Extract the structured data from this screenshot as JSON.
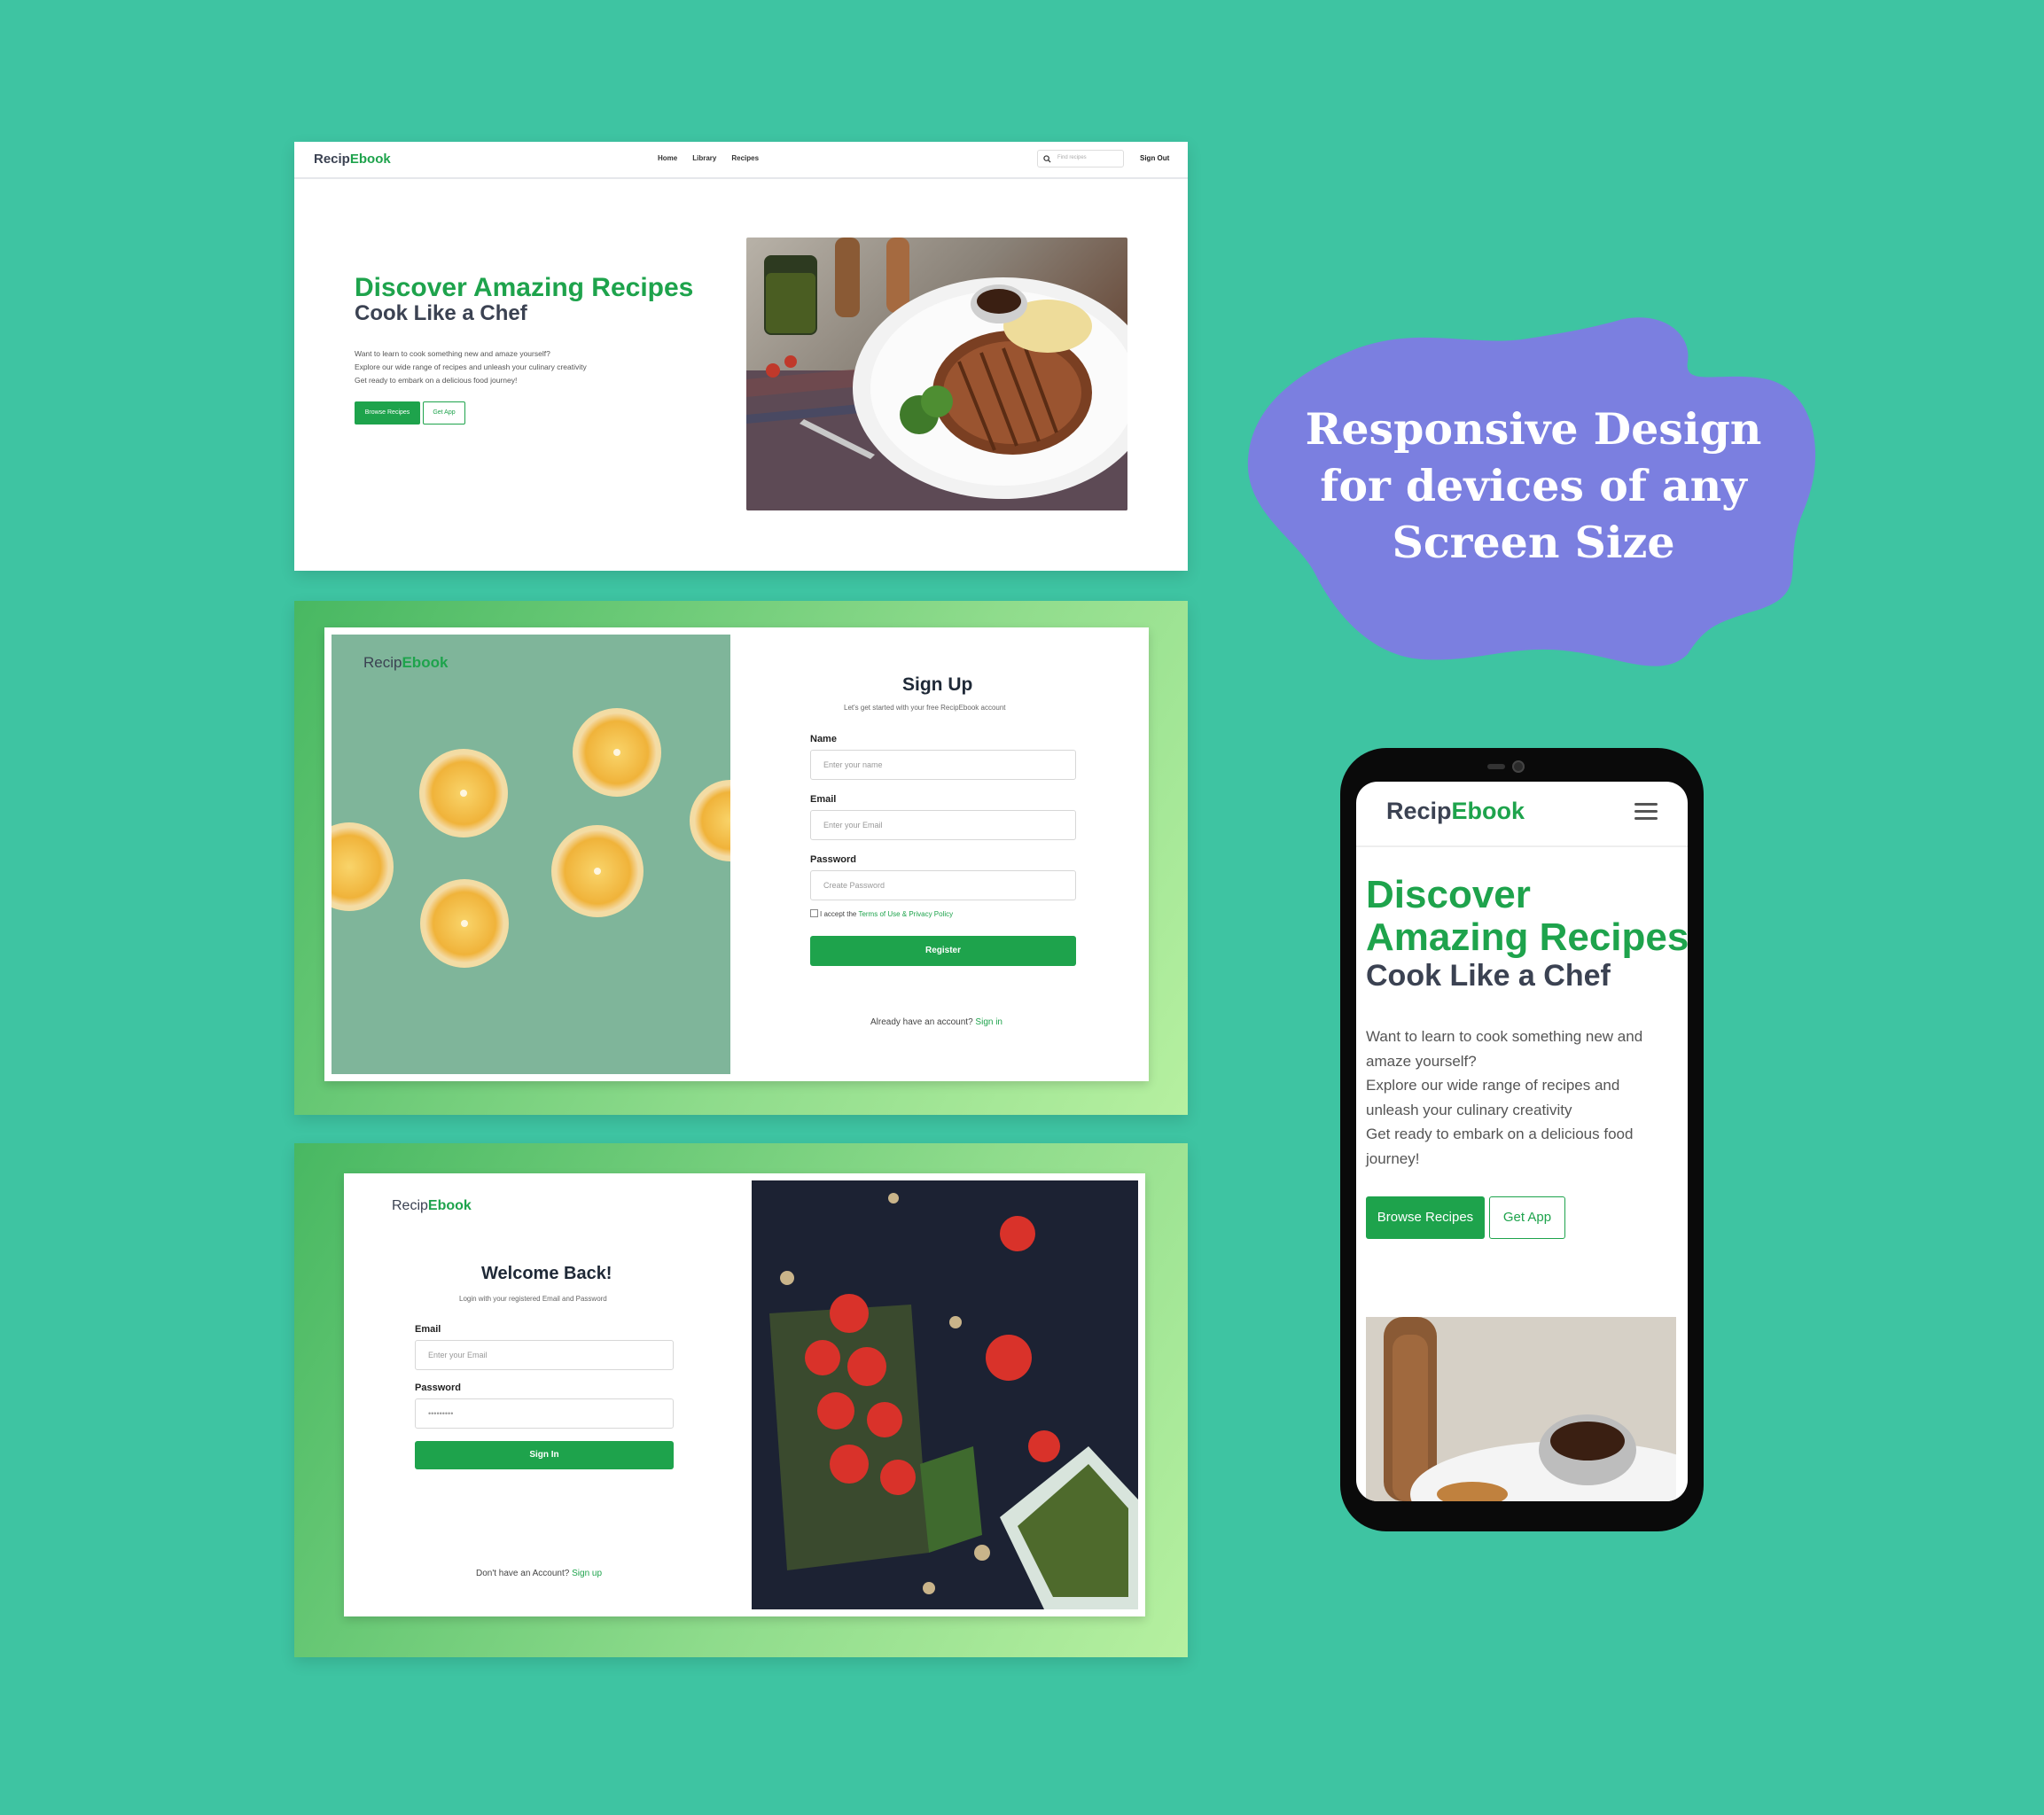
{
  "brand": {
    "part1": "Recip",
    "part2": "Ebook"
  },
  "desktop": {
    "nav": {
      "home": "Home",
      "library": "Library",
      "recipes": "Recipes",
      "search_placeholder": "Find recipes",
      "signout": "Sign Out"
    },
    "hero": {
      "title": "Discover Amazing Recipes",
      "subtitle": "Cook Like a Chef",
      "line1": "Want to learn to cook something new and amaze yourself?",
      "line2": "Explore our wide range of recipes and unleash your culinary creativity",
      "line3": "Get ready to embark on a delicious food journey!",
      "browse": "Browse Recipes",
      "getapp": "Get App"
    }
  },
  "signup": {
    "title": "Sign Up",
    "subtitle": "Let's get started with your free RecipEbook account",
    "name_label": "Name",
    "name_placeholder": "Enter your name",
    "email_label": "Email",
    "email_placeholder": "Enter your Email",
    "password_label": "Password",
    "password_placeholder": "Create Password",
    "terms_prefix": "I accept the ",
    "terms_link": "Terms of Use",
    "terms_amp": " & ",
    "privacy_link": "Privacy Policy",
    "register": "Register",
    "already": "Already have an account? ",
    "signin_link": "Sign in"
  },
  "signin": {
    "title": "Welcome Back!",
    "subtitle": "Login with your registered Email and Password",
    "email_label": "Email",
    "email_placeholder": "Enter your Email",
    "password_label": "Password",
    "password_value": "•••••••••",
    "button": "Sign In",
    "noaccount": "Don't have an Account? ",
    "signup_link": "Sign up"
  },
  "promo": {
    "line1": "Responsive Design",
    "line2": "for devices of any",
    "line3": "Screen Size"
  },
  "mobile": {
    "title": "Discover Amazing Recipes",
    "subtitle": "Cook Like a Chef",
    "desc1": "Want to learn to cook something new and amaze yourself?",
    "desc2": "Explore our wide range of recipes and unleash your culinary creativity",
    "desc3": "Get ready to embark on a delicious food journey!",
    "browse": "Browse Recipes",
    "getapp": "Get App"
  },
  "colors": {
    "background": "#3ec4a2",
    "accent": "#1ea34c",
    "blob": "#7b7fe0",
    "dark_text": "#3b4252"
  },
  "icons": {
    "search": "search-icon",
    "menu": "hamburger-menu-icon"
  }
}
